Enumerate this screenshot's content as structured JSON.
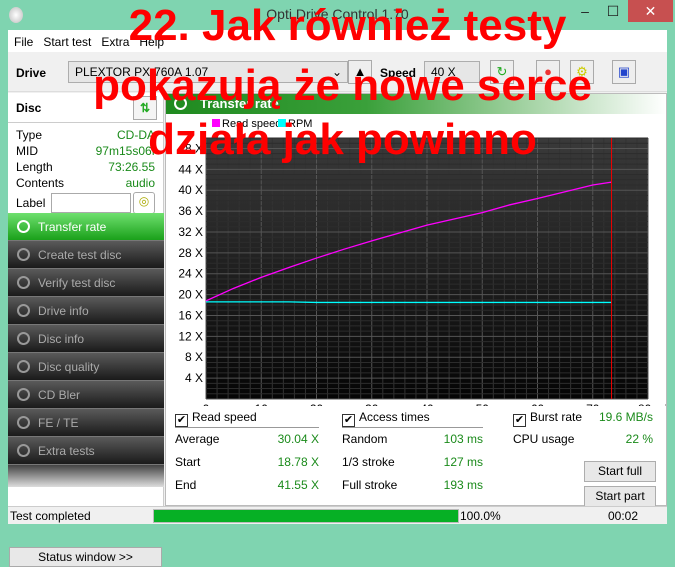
{
  "window": {
    "title": "Opti Drive Control 1.70",
    "minimize": "–",
    "maximize": "☐",
    "close": "✕"
  },
  "menu": [
    "File",
    "Start test",
    "Extra",
    "Help"
  ],
  "toolbar": {
    "drive_label": "Drive",
    "drive_value": "PLEXTOR PX-760A 1.07",
    "speed_label": "Speed",
    "speed_value": "40 X"
  },
  "disc": {
    "title": "Disc",
    "rows": [
      {
        "label": "Type",
        "value": "CD-DA"
      },
      {
        "label": "MID",
        "value": "97m15s06f"
      },
      {
        "label": "Length",
        "value": "73:26.55"
      },
      {
        "label": "Contents",
        "value": "audio"
      }
    ],
    "label_field": "Label"
  },
  "nav": [
    "Transfer rate",
    "Create test disc",
    "Verify test disc",
    "Drive info",
    "Disc info",
    "Disc quality",
    "CD Bler",
    "FE / TE",
    "Extra tests"
  ],
  "status_window": "Status window >>",
  "panel": {
    "title": "Transfer rate"
  },
  "chart_data": {
    "type": "line",
    "legend": [
      "Read speed",
      "RPM"
    ],
    "legend_placement": "top-left",
    "colors": {
      "Read speed": "#ff00ff",
      "RPM": "#00ffff"
    },
    "x_ticks": [
      "0",
      "10",
      "20",
      "30",
      "40",
      "50",
      "60",
      "70",
      "80 min"
    ],
    "y_ticks": [
      "4 X",
      "8 X",
      "12 X",
      "16 X",
      "20 X",
      "24 X",
      "28 X",
      "32 X",
      "36 X",
      "40 X",
      "44 X",
      "48 X"
    ],
    "xlim": [
      0,
      80
    ],
    "ylim": [
      0,
      50
    ],
    "end_marker_x": 73.4,
    "series": [
      {
        "name": "Read speed",
        "x": [
          0,
          5,
          10,
          15,
          20,
          25,
          30,
          35,
          40,
          45,
          50,
          55,
          60,
          65,
          70,
          73.4
        ],
        "y": [
          18.8,
          21.2,
          23.3,
          25.2,
          27.0,
          28.7,
          30.3,
          31.8,
          33.3,
          34.5,
          35.7,
          37.2,
          38.4,
          39.7,
          41.0,
          41.55
        ]
      },
      {
        "name": "RPM",
        "x": [
          0,
          15,
          20,
          30,
          40,
          55,
          60,
          73.4
        ],
        "y": [
          18.6,
          18.6,
          18.5,
          18.5,
          18.5,
          18.5,
          18.5,
          18.5
        ]
      }
    ]
  },
  "stats": {
    "read_speed": {
      "label": "Read speed",
      "checked": true,
      "rows": [
        {
          "label": "Average",
          "value": "30.04 X"
        },
        {
          "label": "Start",
          "value": "18.78 X"
        },
        {
          "label": "End",
          "value": "41.55 X"
        }
      ]
    },
    "access_times": {
      "label": "Access times",
      "checked": true,
      "rows": [
        {
          "label": "Random",
          "value": "103 ms"
        },
        {
          "label": "1/3 stroke",
          "value": "127 ms"
        },
        {
          "label": "Full stroke",
          "value": "193 ms"
        }
      ]
    },
    "burst": {
      "label": "Burst rate",
      "checked": true,
      "value": "19.6 MB/s",
      "cpu_label": "CPU usage",
      "cpu_value": "22 %"
    },
    "start_full": "Start full",
    "start_part": "Start part"
  },
  "statusbar": {
    "text": "Test completed",
    "progress": 100,
    "progress_text": "100.0%",
    "time": "00:02"
  },
  "overlay": {
    "lines": [
      "22. Jak również testy",
      "pokazują że nowe serce",
      "działa jak powinno"
    ],
    "color": "#ff0000"
  }
}
